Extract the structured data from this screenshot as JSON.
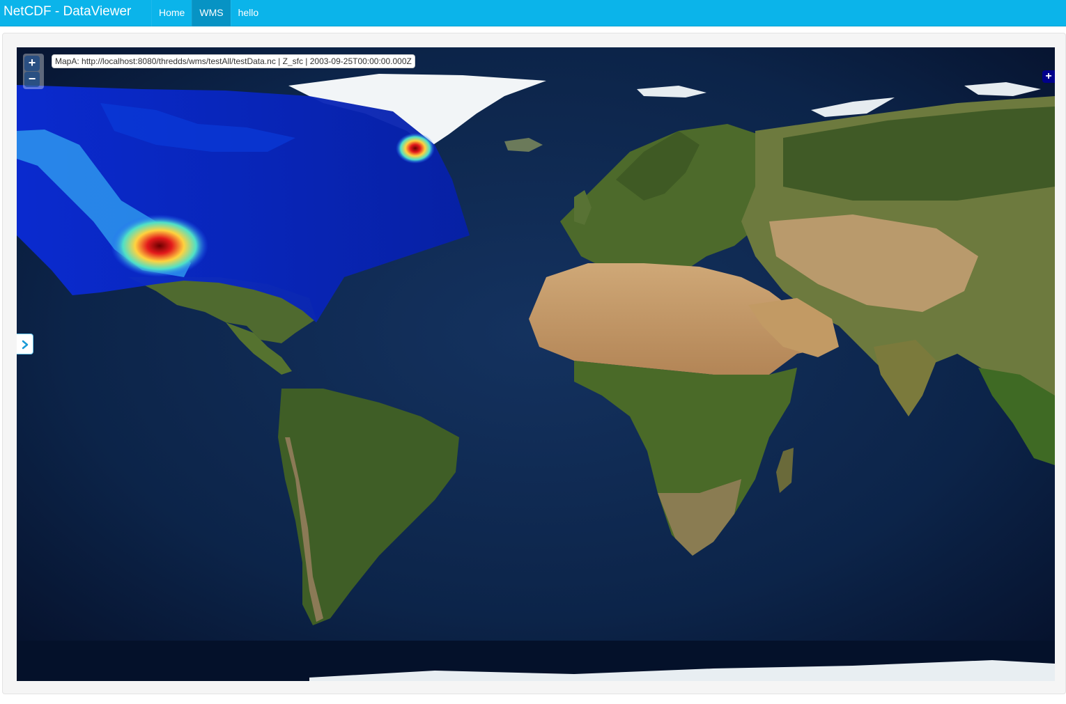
{
  "navbar": {
    "brand": "NetCDF - DataViewer",
    "items": [
      {
        "label": "Home",
        "active": false
      },
      {
        "label": "WMS",
        "active": true
      },
      {
        "label": "hello",
        "active": false
      }
    ],
    "background_color": "#0bb4ea",
    "active_color": "#0793c4"
  },
  "map": {
    "layer_label": "MapA: http://localhost:8080/thredds/wms/testAll/testData.nc | Z_sfc | 2003-09-25T00:00:00.000Z",
    "zoom_in_label": "+",
    "zoom_out_label": "−",
    "layer_switcher_label": "+",
    "side_toggle_icon": "chevron-right-icon",
    "base_layer": "satellite-world-imagery",
    "overlay_layer": "wms-data-heatmap"
  }
}
